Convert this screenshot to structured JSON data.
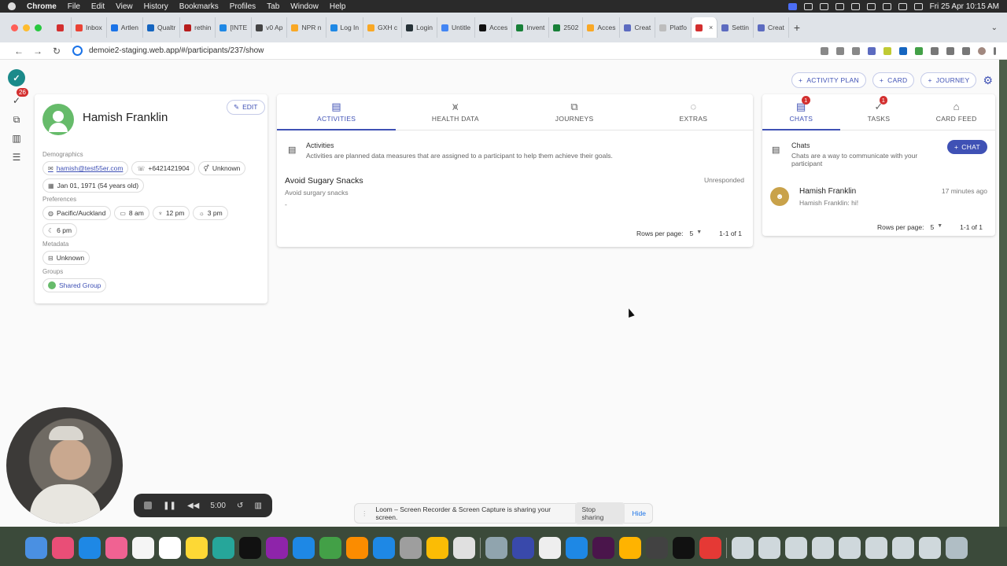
{
  "menubar": {
    "app_name": "Chrome",
    "items": [
      "File",
      "Edit",
      "View",
      "History",
      "Bookmarks",
      "Profiles",
      "Tab",
      "Window",
      "Help"
    ],
    "clock": "Fri 25 Apr  10:15 AM"
  },
  "browser": {
    "tabs": [
      {
        "label": "",
        "color": "#d32f2f"
      },
      {
        "label": "Inbox",
        "color": "#ea4335"
      },
      {
        "label": "Artlen",
        "color": "#1a73e8"
      },
      {
        "label": "Qualtr",
        "color": "#1565c0"
      },
      {
        "label": "rethin",
        "color": "#b71c1c"
      },
      {
        "label": "[INTE",
        "color": "#1e88e5"
      },
      {
        "label": "v0 Ap",
        "color": "#444444"
      },
      {
        "label": "NPR n",
        "color": "#f9a825"
      },
      {
        "label": "Log In",
        "color": "#1e88e5"
      },
      {
        "label": "GXH c",
        "color": "#f9a825"
      },
      {
        "label": "Login",
        "color": "#263238"
      },
      {
        "label": "Untitle",
        "color": "#4285f4"
      },
      {
        "label": "Acces",
        "color": "#111111"
      },
      {
        "label": "Invent",
        "color": "#188038"
      },
      {
        "label": "2502",
        "color": "#188038"
      },
      {
        "label": "Acces",
        "color": "#f9a825"
      },
      {
        "label": "Creat",
        "color": "#5c6bc0"
      },
      {
        "label": "Platfo",
        "color": "#bdbdbd"
      },
      {
        "label": "",
        "color": "#d32f2f",
        "active": true
      },
      {
        "label": "Settin",
        "color": "#5c6bc0"
      },
      {
        "label": "Creat",
        "color": "#5c6bc0"
      }
    ],
    "url": "demoie2-staging.web.app/#/participants/237/show"
  },
  "app": {
    "nav_badge": "26",
    "top_actions": {
      "activity_plan": "ACTIVITY PLAN",
      "card": "CARD",
      "journey": "JOURNEY"
    },
    "profile": {
      "name": "Hamish Franklin",
      "edit_label": "EDIT",
      "demographics_label": "Demographics",
      "email": "hamish@test55er.com",
      "phone": "+6421421904",
      "gender": "Unknown",
      "dob": "Jan 01, 1971 (54 years old)",
      "preferences_label": "Preferences",
      "timezone": "Pacific/Auckland",
      "wake_time": "8 am",
      "meal_time": "12 pm",
      "afternoon_time": "3 pm",
      "night_time": "6 pm",
      "metadata_label": "Metadata",
      "metadata_value": "Unknown",
      "groups_label": "Groups",
      "group_name": "Shared Group"
    },
    "center_tabs": [
      {
        "label": "ACTIVITIES",
        "icon": "activities-icon",
        "glyph": "▤",
        "active": true
      },
      {
        "label": "HEALTH DATA",
        "icon": "health-data-icon",
        "glyph": "⩙"
      },
      {
        "label": "JOURNEYS",
        "icon": "journeys-icon",
        "glyph": "⧉"
      },
      {
        "label": "EXTRAS",
        "icon": "extras-icon",
        "glyph": "◌"
      }
    ],
    "activities": {
      "title": "Activities",
      "description": "Activities are planned data measures that are assigned to a participant to help them achieve their goals.",
      "items": [
        {
          "title": "Avoid Sugary Snacks",
          "subtitle": "Avoid surgary snacks",
          "detail": "-",
          "status": "Unresponded"
        }
      ],
      "rows_per_page_label": "Rows per page:",
      "rows_per_page": "5",
      "range": "1-1 of 1"
    },
    "right_tabs": [
      {
        "label": "CHATS",
        "icon": "chat-bubble-icon",
        "glyph": "▤",
        "active": true,
        "badge": "1"
      },
      {
        "label": "TASKS",
        "icon": "tasks-icon",
        "glyph": "✓",
        "badge": "1"
      },
      {
        "label": "CARD FEED",
        "icon": "home-icon",
        "glyph": "⌂"
      }
    ],
    "chats": {
      "title": "Chats",
      "description": "Chats are a way to communicate with your participant",
      "new_chat_label": "CHAT",
      "items": [
        {
          "name": "Hamish Franklin",
          "message": "Hamish Franklin: hi!",
          "time": "17 minutes ago"
        }
      ],
      "rows_per_page_label": "Rows per page:",
      "rows_per_page": "5",
      "range": "1-1 of 1"
    }
  },
  "loom": {
    "timer": "5:00",
    "share_message": "Loom – Screen Recorder & Screen Capture is sharing your screen.",
    "stop_sharing": "Stop sharing",
    "hide": "Hide"
  },
  "colors": {
    "primary": "#3f51b5",
    "badge": "#d32f2f",
    "avatar_green": "#66bb6a"
  }
}
